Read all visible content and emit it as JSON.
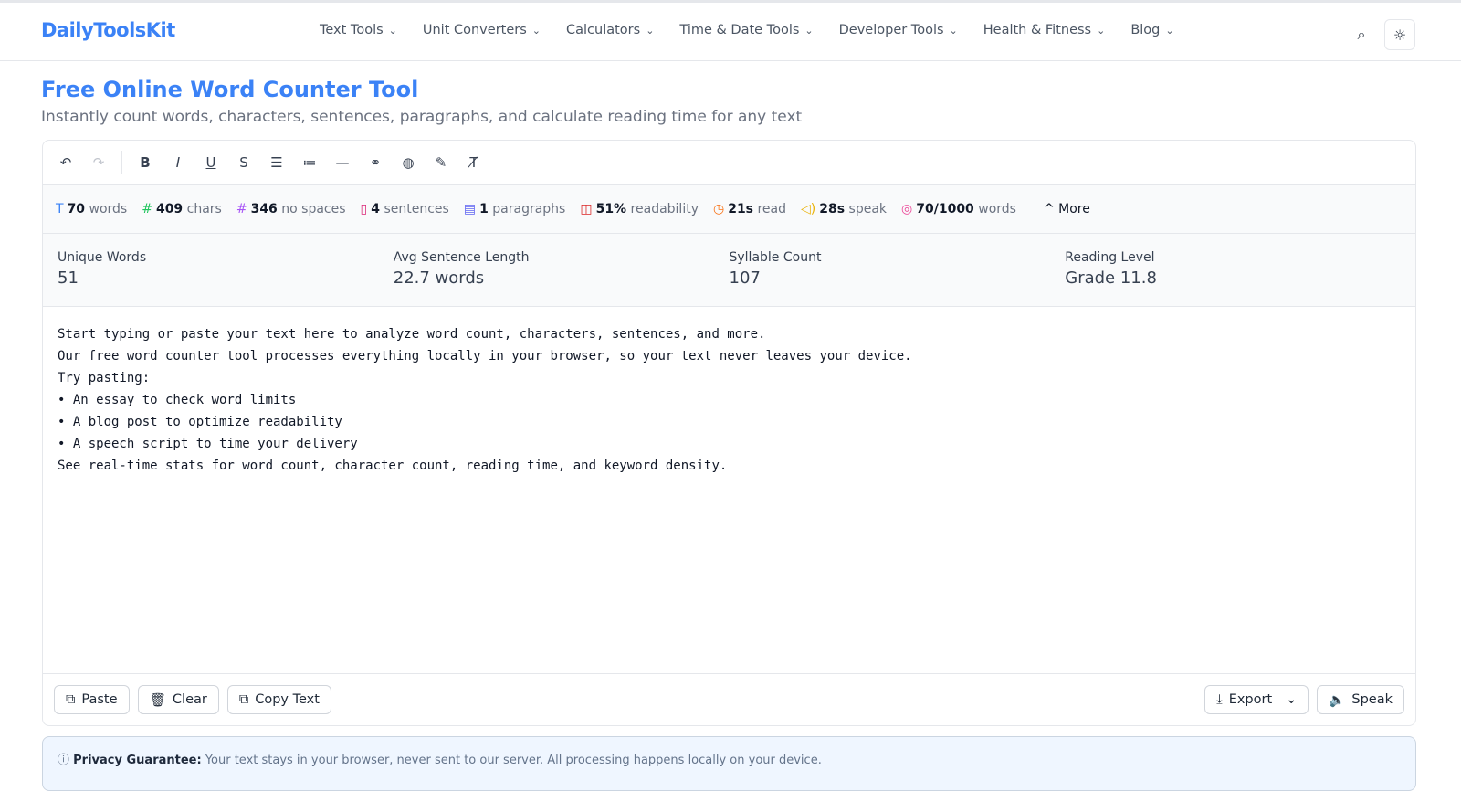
{
  "brand": "DailyToolsKit",
  "nav": [
    "Text Tools",
    "Unit Converters",
    "Calculators",
    "Time & Date Tools",
    "Developer Tools",
    "Health & Fitness",
    "Blog"
  ],
  "title": "Free Online Word Counter Tool",
  "subtitle": "Instantly count words, characters, sentences, paragraphs, and calculate reading time for any text",
  "stats": [
    {
      "icon": "T",
      "color": "#3b82f6",
      "value": "70",
      "label": "words"
    },
    {
      "icon": "#",
      "color": "#22c55e",
      "value": "409",
      "label": "chars"
    },
    {
      "icon": "#",
      "color": "#a855f7",
      "value": "346",
      "label": "no spaces"
    },
    {
      "icon": "▯",
      "color": "#db2777",
      "value": "4",
      "label": "sentences"
    },
    {
      "icon": "▤",
      "color": "#6366f1",
      "value": "1",
      "label": "paragraphs"
    },
    {
      "icon": "◫",
      "color": "#dc2626",
      "value": "51%",
      "label": "readability"
    },
    {
      "icon": "◷",
      "color": "#f97316",
      "value": "21s",
      "label": "read"
    },
    {
      "icon": "◁)",
      "color": "#eab308",
      "value": "28s",
      "label": "speak"
    },
    {
      "icon": "◎",
      "color": "#ec4899",
      "value": "70/1000",
      "label": "words"
    }
  ],
  "more_label": "More",
  "metrics": [
    {
      "label": "Unique Words",
      "value": "51"
    },
    {
      "label": "Avg Sentence Length",
      "value": "22.7 words"
    },
    {
      "label": "Syllable Count",
      "value": "107"
    },
    {
      "label": "Reading Level",
      "value": "Grade 11.8"
    }
  ],
  "editor_text": "Start typing or paste your text here to analyze word count, characters, sentences, and more.\nOur free word counter tool processes everything locally in your browser, so your text never leaves your device.\nTry pasting:\n• An essay to check word limits\n• A blog post to optimize readability\n• A speech script to time your delivery\nSee real-time stats for word count, character count, reading time, and keyword density.",
  "buttons": {
    "paste": "Paste",
    "clear": "Clear",
    "copy": "Copy Text",
    "export": "Export",
    "speak": "Speak"
  },
  "privacy": {
    "title": "Privacy Guarantee:",
    "text": "Your text stays in your browser, never sent to our server. All processing happens locally on your device."
  }
}
